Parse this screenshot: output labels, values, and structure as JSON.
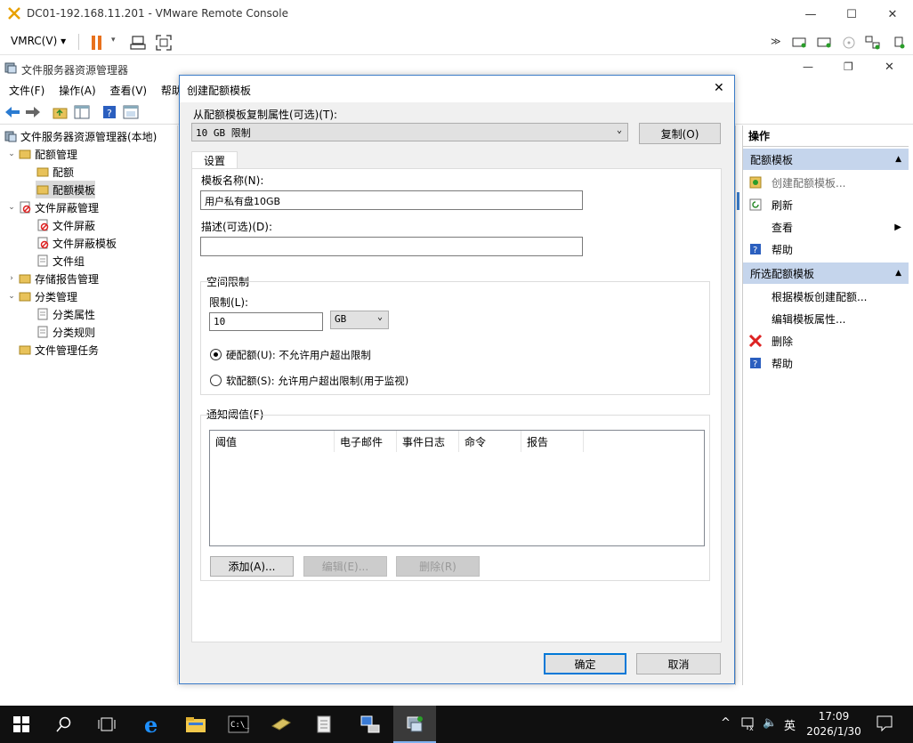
{
  "vmrc": {
    "title": "DC01-192.168.11.201 - VMware Remote Console",
    "menu_label": "VMRC(V)"
  },
  "mmc": {
    "title": "文件服务器资源管理器",
    "menu": [
      "文件(F)",
      "操作(A)",
      "查看(V)",
      "帮助"
    ]
  },
  "tree": [
    {
      "label": "文件服务器资源管理器(本地)",
      "icon": "server-icon",
      "level": 0,
      "expander": ""
    },
    {
      "label": "配额管理",
      "icon": "quota-mgmt-icon",
      "level": 1,
      "expander": "v"
    },
    {
      "label": "配额",
      "icon": "quota-icon",
      "level": 2,
      "expander": ""
    },
    {
      "label": "配额模板",
      "icon": "quota-template-icon",
      "level": 2,
      "expander": "",
      "selected": true
    },
    {
      "label": "文件屏蔽管理",
      "icon": "file-screen-mgmt-icon",
      "level": 1,
      "expander": "v"
    },
    {
      "label": "文件屏蔽",
      "icon": "file-screen-icon",
      "level": 2,
      "expander": ""
    },
    {
      "label": "文件屏蔽模板",
      "icon": "file-screen-template-icon",
      "level": 2,
      "expander": ""
    },
    {
      "label": "文件组",
      "icon": "file-group-icon",
      "level": 2,
      "expander": ""
    },
    {
      "label": "存储报告管理",
      "icon": "storage-report-icon",
      "level": 1,
      "expander": ">"
    },
    {
      "label": "分类管理",
      "icon": "classification-icon",
      "level": 1,
      "expander": "v"
    },
    {
      "label": "分类属性",
      "icon": "class-property-icon",
      "level": 2,
      "expander": ""
    },
    {
      "label": "分类规则",
      "icon": "class-rule-icon",
      "level": 2,
      "expander": ""
    },
    {
      "label": "文件管理任务",
      "icon": "file-task-icon",
      "level": 1,
      "expander": ""
    }
  ],
  "actions": {
    "header": "操作",
    "section1": "配额模板",
    "section1_items": [
      {
        "label": "创建配额模板...",
        "icon": "create-template-icon",
        "disabled": true
      },
      {
        "label": "刷新",
        "icon": "refresh-icon"
      },
      {
        "label": "查看",
        "icon": "",
        "submenu": true
      },
      {
        "label": "帮助",
        "icon": "help-icon"
      }
    ],
    "section2": "所选配额模板",
    "section2_items": [
      {
        "label": "根据模板创建配额...",
        "icon": ""
      },
      {
        "label": "编辑模板属性...",
        "icon": ""
      },
      {
        "label": "删除",
        "icon": "delete-icon"
      },
      {
        "label": "帮助",
        "icon": "help-icon"
      }
    ]
  },
  "dialog": {
    "title": "创建配额模板",
    "copy_from_label": "从配额模板复制属性(可选)(T):",
    "copy_from_value": "10 GB 限制",
    "copy_button": "复制(O)",
    "tab": "设置",
    "template_name_label": "模板名称(N):",
    "template_name_value": "用户私有盘10GB",
    "description_label": "描述(可选)(D):",
    "description_value": "",
    "space_limit_group": "空间限制",
    "limit_label": "限制(L):",
    "limit_value": "10",
    "unit_value": "GB",
    "hard_quota_label": "硬配额(U): 不允许用户超出限制",
    "hard_quota_selected": true,
    "soft_quota_label": "软配额(S): 允许用户超出限制(用于监视)",
    "soft_quota_selected": false,
    "threshold_group": "通知阈值(F)",
    "threshold_columns": [
      "阈值",
      "电子邮件",
      "事件日志",
      "命令",
      "报告"
    ],
    "add_button": "添加(A)...",
    "edit_button": "编辑(E)...",
    "delete_button": "删除(R)",
    "ok_button": "确定",
    "cancel_button": "取消"
  },
  "taskbar": {
    "time": "17:09",
    "date": "2026/1/30",
    "ime": "英"
  }
}
